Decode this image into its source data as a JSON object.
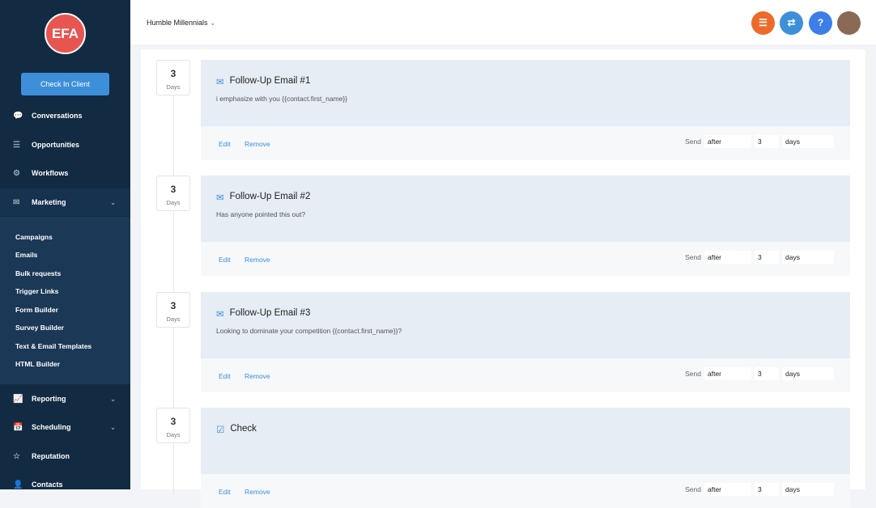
{
  "sidebar": {
    "logo": "EFA",
    "check_in": "Check In Client",
    "items": [
      {
        "i": "💬",
        "l": "Conversations"
      },
      {
        "i": "☰",
        "l": "Opportunities"
      },
      {
        "i": "⚙",
        "l": "Workflows"
      },
      {
        "i": "✉",
        "l": "Marketing"
      }
    ],
    "sub": [
      "Campaigns",
      "Emails",
      "Bulk requests",
      "Trigger Links",
      "Form Builder",
      "Survey Builder",
      "Text & Email Templates",
      "HTML Builder"
    ],
    "items2": [
      {
        "i": "📈",
        "l": "Reporting"
      },
      {
        "i": "📅",
        "l": "Scheduling"
      },
      {
        "i": "☆",
        "l": "Reputation"
      },
      {
        "i": "👤",
        "l": "Contacts"
      }
    ]
  },
  "header": {
    "account": "Humble Millennials"
  },
  "steps": [
    {
      "d": "3",
      "u": "Days",
      "t": "Follow-Up Email #1",
      "b": "i emphasize with you {{contact.first_name}}",
      "e": "Edit",
      "r": "Remove",
      "s": "Send",
      "w": "after",
      "v": "3",
      "un": "days"
    },
    {
      "d": "3",
      "u": "Days",
      "t": "Follow-Up Email #2",
      "b": "Has anyone pointed this out?",
      "e": "Edit",
      "r": "Remove",
      "s": "Send",
      "w": "after",
      "v": "3",
      "un": "days"
    },
    {
      "d": "3",
      "u": "Days",
      "t": "Follow-Up Email #3",
      "b": "Looking to dominate your competition {{contact.first_name}}?",
      "e": "Edit",
      "r": "Remove",
      "s": "Send",
      "w": "after",
      "v": "3",
      "un": "days"
    },
    {
      "d": "3",
      "u": "Days",
      "t": "Check",
      "b": "",
      "e": "Edit",
      "r": "Remove",
      "s": "Send",
      "w": "after",
      "v": "3",
      "un": "days"
    }
  ]
}
